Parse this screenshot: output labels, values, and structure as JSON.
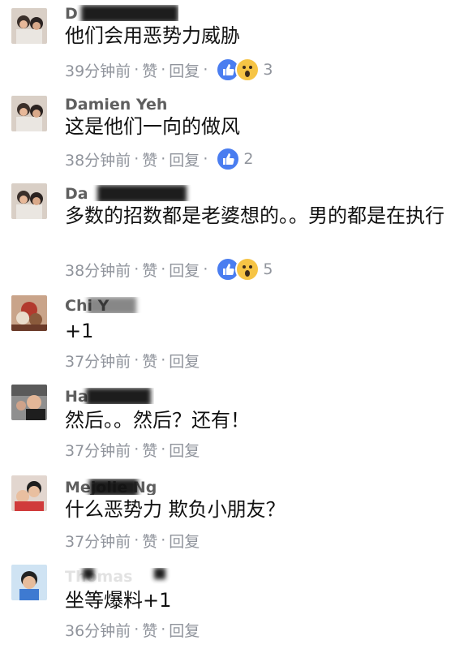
{
  "comments": [
    {
      "name": "D",
      "text": "他们会用恶势力威胁",
      "time": "39分钟前",
      "like": "赞",
      "reply": "回复",
      "reactions": [
        "like",
        "wow"
      ],
      "count": "3"
    },
    {
      "name": "Damien Yeh",
      "text": "这是他们一向的做风",
      "time": "38分钟前",
      "like": "赞",
      "reply": "回复",
      "reactions": [
        "like"
      ],
      "count": "2"
    },
    {
      "name": "Da",
      "text": "多数的招数都是老婆想的。。男的都是在执行",
      "time": "38分钟前",
      "like": "赞",
      "reply": "回复",
      "reactions": [
        "like",
        "wow"
      ],
      "count": "5"
    },
    {
      "name": "Chi Y",
      "text": "+1",
      "time": "37分钟前",
      "like": "赞",
      "reply": "回复",
      "reactions": [],
      "count": ""
    },
    {
      "name": "Ha",
      "text": "然后。。然后？还有！",
      "time": "37分钟前",
      "like": "赞",
      "reply": "回复",
      "reactions": [],
      "count": ""
    },
    {
      "name": "Mejolie Ng",
      "text": "什么恶势力 欺负小朋友？",
      "time": "37分钟前",
      "like": "赞",
      "reply": "回复",
      "reactions": [],
      "count": ""
    },
    {
      "name": "Thomas",
      "text": "坐等爆料+1",
      "time": "36分钟前",
      "like": "赞",
      "reply": "回复",
      "reactions": [],
      "count": ""
    }
  ],
  "separator": "·",
  "colors": {
    "like": "#4a7df0",
    "wow": "#f6c445",
    "meta": "#90949c"
  },
  "icons": {
    "like": "thumbs-up-icon",
    "wow": "wow-face-icon"
  }
}
